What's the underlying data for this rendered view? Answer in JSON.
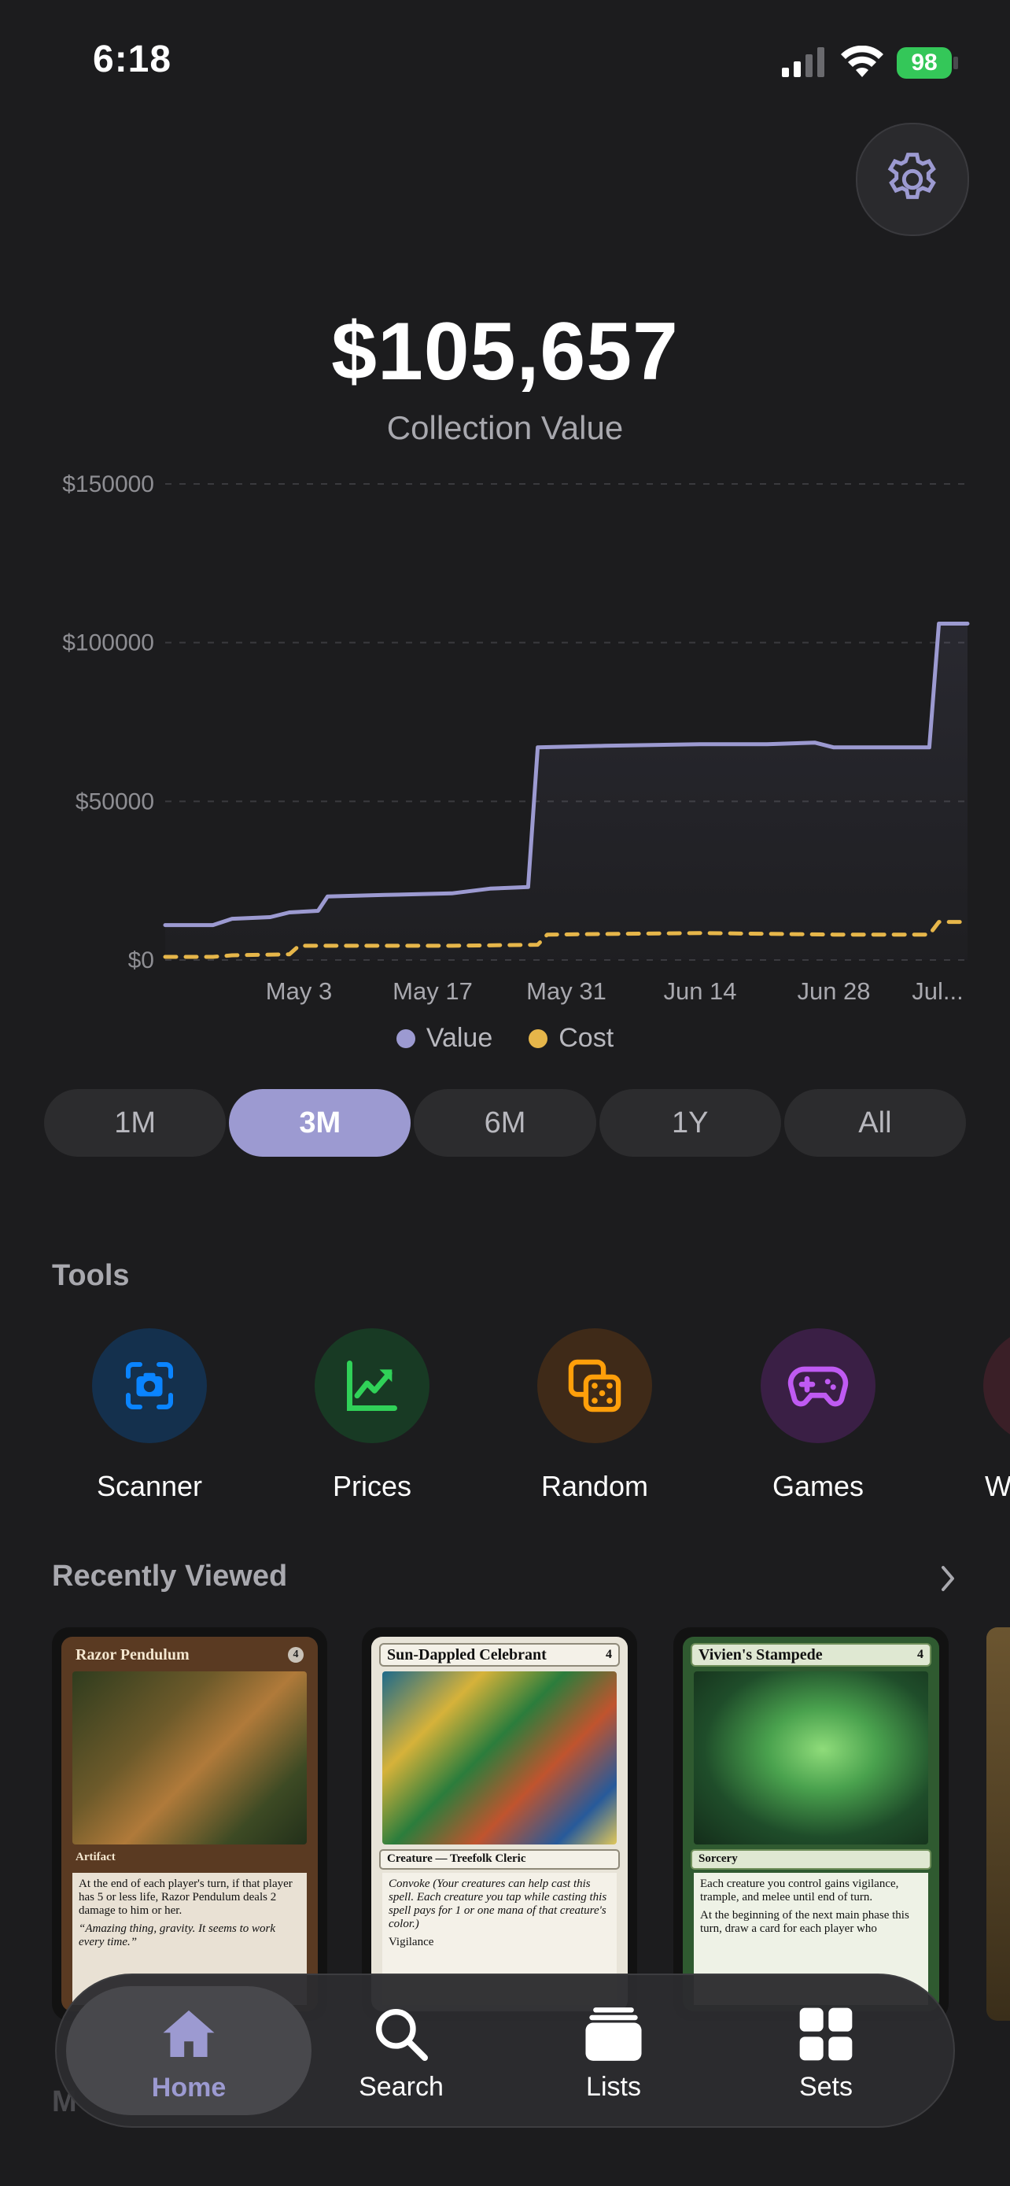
{
  "status_bar": {
    "time": "6:18",
    "battery": "98"
  },
  "header": {
    "total_value": "$105,657",
    "total_label": "Collection Value"
  },
  "chart_data": {
    "type": "line",
    "x_ticks": [
      "May 3",
      "May 17",
      "May 31",
      "Jun 14",
      "Jun 28",
      "Jul..."
    ],
    "y_ticks": [
      "$150000",
      "$100000",
      "$50000",
      "$0"
    ],
    "ylim": [
      0,
      150000
    ],
    "grid": true,
    "legend_position": "bottom",
    "series": [
      {
        "name": "Value",
        "color": "#9c9ad1",
        "points": [
          [
            "Apr 19",
            11000
          ],
          [
            "Apr 24",
            11000
          ],
          [
            "Apr 26",
            13000
          ],
          [
            "Apr 30",
            13500
          ],
          [
            "May 2",
            15000
          ],
          [
            "May 5",
            15500
          ],
          [
            "May 6",
            20000
          ],
          [
            "May 12",
            20500
          ],
          [
            "May 19",
            21000
          ],
          [
            "May 23",
            22500
          ],
          [
            "May 27",
            23000
          ],
          [
            "May 28",
            67000
          ],
          [
            "Jun 4",
            67500
          ],
          [
            "Jun 14",
            68000
          ],
          [
            "Jun 21",
            68000
          ],
          [
            "Jun 26",
            68500
          ],
          [
            "Jun 28",
            67000
          ],
          [
            "Jul 8",
            67000
          ],
          [
            "Jul 9",
            106000
          ],
          [
            "Jul 12",
            106000
          ]
        ]
      },
      {
        "name": "Cost",
        "color": "#e6b64a",
        "points": [
          [
            "Apr 19",
            1000
          ],
          [
            "Apr 24",
            1000
          ],
          [
            "Apr 26",
            1500
          ],
          [
            "May 2",
            1800
          ],
          [
            "May 3",
            4500
          ],
          [
            "May 19",
            4500
          ],
          [
            "May 28",
            4800
          ],
          [
            "May 29",
            8000
          ],
          [
            "Jun 14",
            8500
          ],
          [
            "Jun 28",
            8000
          ],
          [
            "Jul 8",
            8000
          ],
          [
            "Jul 9",
            12000
          ],
          [
            "Jul 12",
            12000
          ]
        ]
      }
    ]
  },
  "legend": {
    "value_label": "Value",
    "cost_label": "Cost",
    "value_color": "#9c9ad1",
    "cost_color": "#e6b64a"
  },
  "ranges": {
    "items": [
      "1M",
      "3M",
      "6M",
      "1Y",
      "All"
    ],
    "selected": "3M"
  },
  "tools": {
    "title": "Tools",
    "items": [
      {
        "label": "Scanner",
        "icon": "camera-scan-icon",
        "color": "#0a84ff"
      },
      {
        "label": "Prices",
        "icon": "trend-chart-icon",
        "color": "#30d158"
      },
      {
        "label": "Random",
        "icon": "dice-icon",
        "color": "#ff9f0a"
      },
      {
        "label": "Games",
        "icon": "gamepad-icon",
        "color": "#bf5af2"
      },
      {
        "label": "W",
        "icon": "partial-tool-icon",
        "color": "#ff375f"
      }
    ]
  },
  "recently_viewed": {
    "title": "Recently Viewed",
    "cards": [
      {
        "name": "Razor Pendulum",
        "cost": "4",
        "type": "Artifact",
        "text": "At the end of each player's turn, if that player has 5 or less life, Razor Pendulum deals 2 damage to him or her.",
        "flavor": "“Amazing thing, gravity. It seems to work every time.”"
      },
      {
        "name": "Sun-Dappled Celebrant",
        "cost": "4",
        "type": "Creature — Treefolk Cleric",
        "text": "Convoke (Your creatures can help cast this spell. Each creature you tap while casting this spell pays for 1 or one mana of that creature's color.)",
        "flavor": "Vigilance"
      },
      {
        "name": "Vivien's Stampede",
        "cost": "4",
        "type": "Sorcery",
        "text": "Each creature you control gains vigilance, trample, and melee until end of turn.",
        "flavor": "At the beginning of the next main phase this turn, draw a card for each player who"
      }
    ]
  },
  "tab_bar": {
    "items": [
      {
        "label": "Home",
        "icon": "house-icon"
      },
      {
        "label": "Search",
        "icon": "magnifier-icon"
      },
      {
        "label": "Lists",
        "icon": "stack-icon"
      },
      {
        "label": "Sets",
        "icon": "grid-icon"
      }
    ],
    "active": "Home"
  }
}
